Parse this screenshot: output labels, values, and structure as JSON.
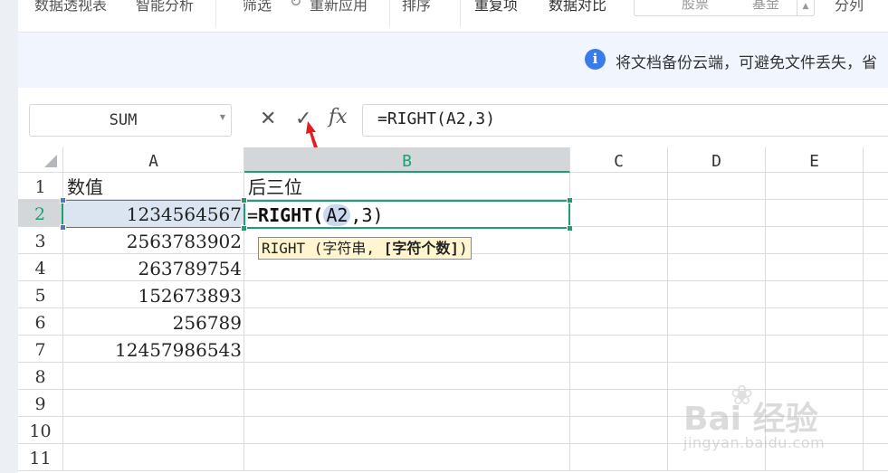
{
  "ribbon": {
    "items": [
      "数据透视表",
      "智能分析",
      "筛选",
      "重新应用",
      "排序",
      "重复项",
      "数据对比"
    ],
    "select_left": "股票",
    "select_right": "基金",
    "last_item": "分列"
  },
  "notice": {
    "icon": "i",
    "text": "将文档备份云端，可避免文件丢失，省"
  },
  "formula_bar": {
    "name_box": "SUM",
    "cancel_icon": "✕",
    "confirm_icon": "✓",
    "fx_label": "fx",
    "formula": "=RIGHT(A2,3)"
  },
  "columns": [
    "A",
    "B",
    "C",
    "D",
    "E"
  ],
  "rows": [
    "1",
    "2",
    "3",
    "4",
    "5",
    "6",
    "7",
    "8",
    "9",
    "10",
    "11"
  ],
  "cells": {
    "A1": "数值",
    "B1": "后三位",
    "A2": "1234564567",
    "A3": "2563783902",
    "A4": "263789754",
    "A5": "152673893",
    "A6": "256789",
    "A7": "12457986543"
  },
  "editor": {
    "prefix": "=",
    "fn": "RIGHT",
    "open": "(",
    "ref": "A2",
    "rest": ",3)"
  },
  "tooltip": {
    "prefix": "RIGHT (字符串, ",
    "bold": "[字符个数]",
    "suffix": ")"
  },
  "watermark": {
    "logo": "Bai  经验",
    "url": "jingyan.baidu.com"
  },
  "colors": {
    "accent": "#1e9f6e",
    "selection": "#4a79c9",
    "info": "#3a7bec",
    "arrow": "#e02020"
  }
}
